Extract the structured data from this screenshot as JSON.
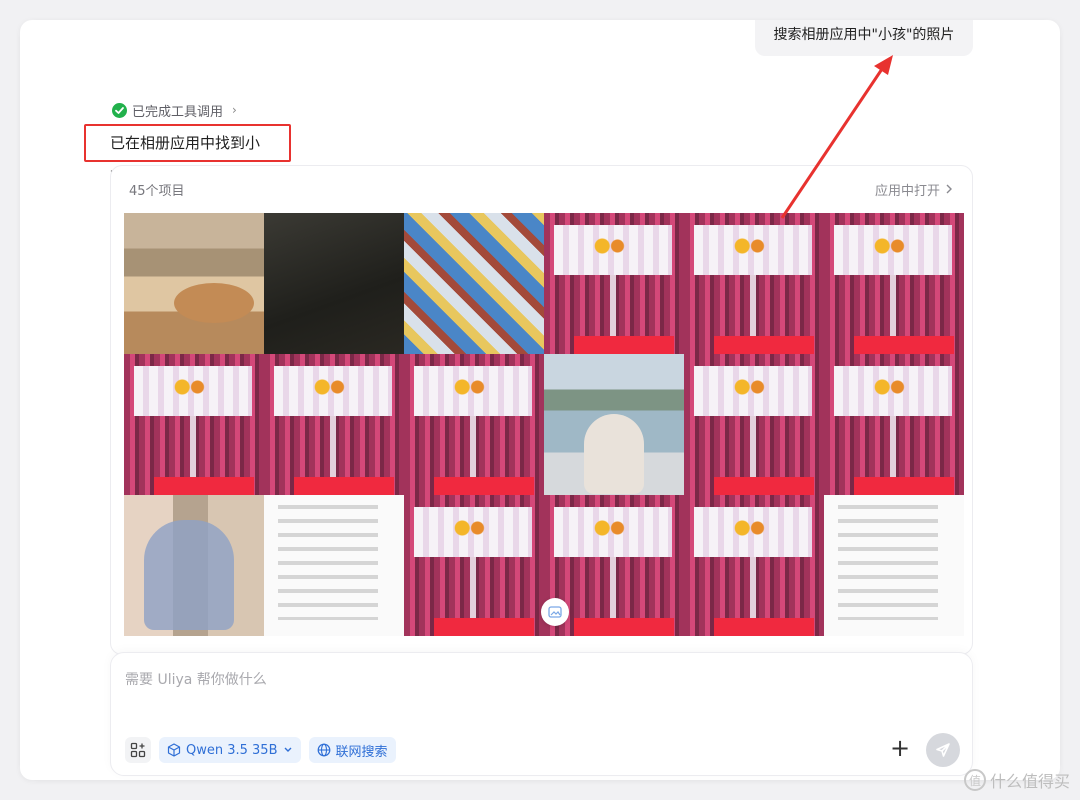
{
  "user_message": "搜索相册应用中\"小孩\"的照片",
  "tool_status": {
    "label": "已完成工具调用",
    "chevron": "›"
  },
  "answer": "已在相册应用中找到小孩：",
  "album": {
    "count_label": "45个项目",
    "open_label": "应用中打开",
    "thumbnails": [
      {
        "kind": "food-icon"
      },
      {
        "kind": "dark-photo-icon"
      },
      {
        "kind": "toys-icon"
      },
      {
        "kind": "poster-icon"
      },
      {
        "kind": "poster-icon"
      },
      {
        "kind": "poster-icon"
      },
      {
        "kind": "poster-icon"
      },
      {
        "kind": "poster-icon"
      },
      {
        "kind": "poster-icon"
      },
      {
        "kind": "lake-photo-icon"
      },
      {
        "kind": "poster-icon"
      },
      {
        "kind": "poster-icon"
      },
      {
        "kind": "child-photo-icon"
      },
      {
        "kind": "document-icon"
      },
      {
        "kind": "poster-icon"
      },
      {
        "kind": "poster-icon"
      },
      {
        "kind": "poster-icon"
      },
      {
        "kind": "document-icon"
      }
    ]
  },
  "composer": {
    "placeholder": "需要 Uliya 帮你做什么",
    "model_label": "Qwen 3.5 35B",
    "search_label": "联网搜索",
    "plus_label": "+"
  },
  "watermark": {
    "text": "什么值得买",
    "icon_text": "值"
  },
  "colors": {
    "accent_blue": "#2f6fd6",
    "annotation_red": "#e8322f",
    "success_green": "#22b14c"
  }
}
